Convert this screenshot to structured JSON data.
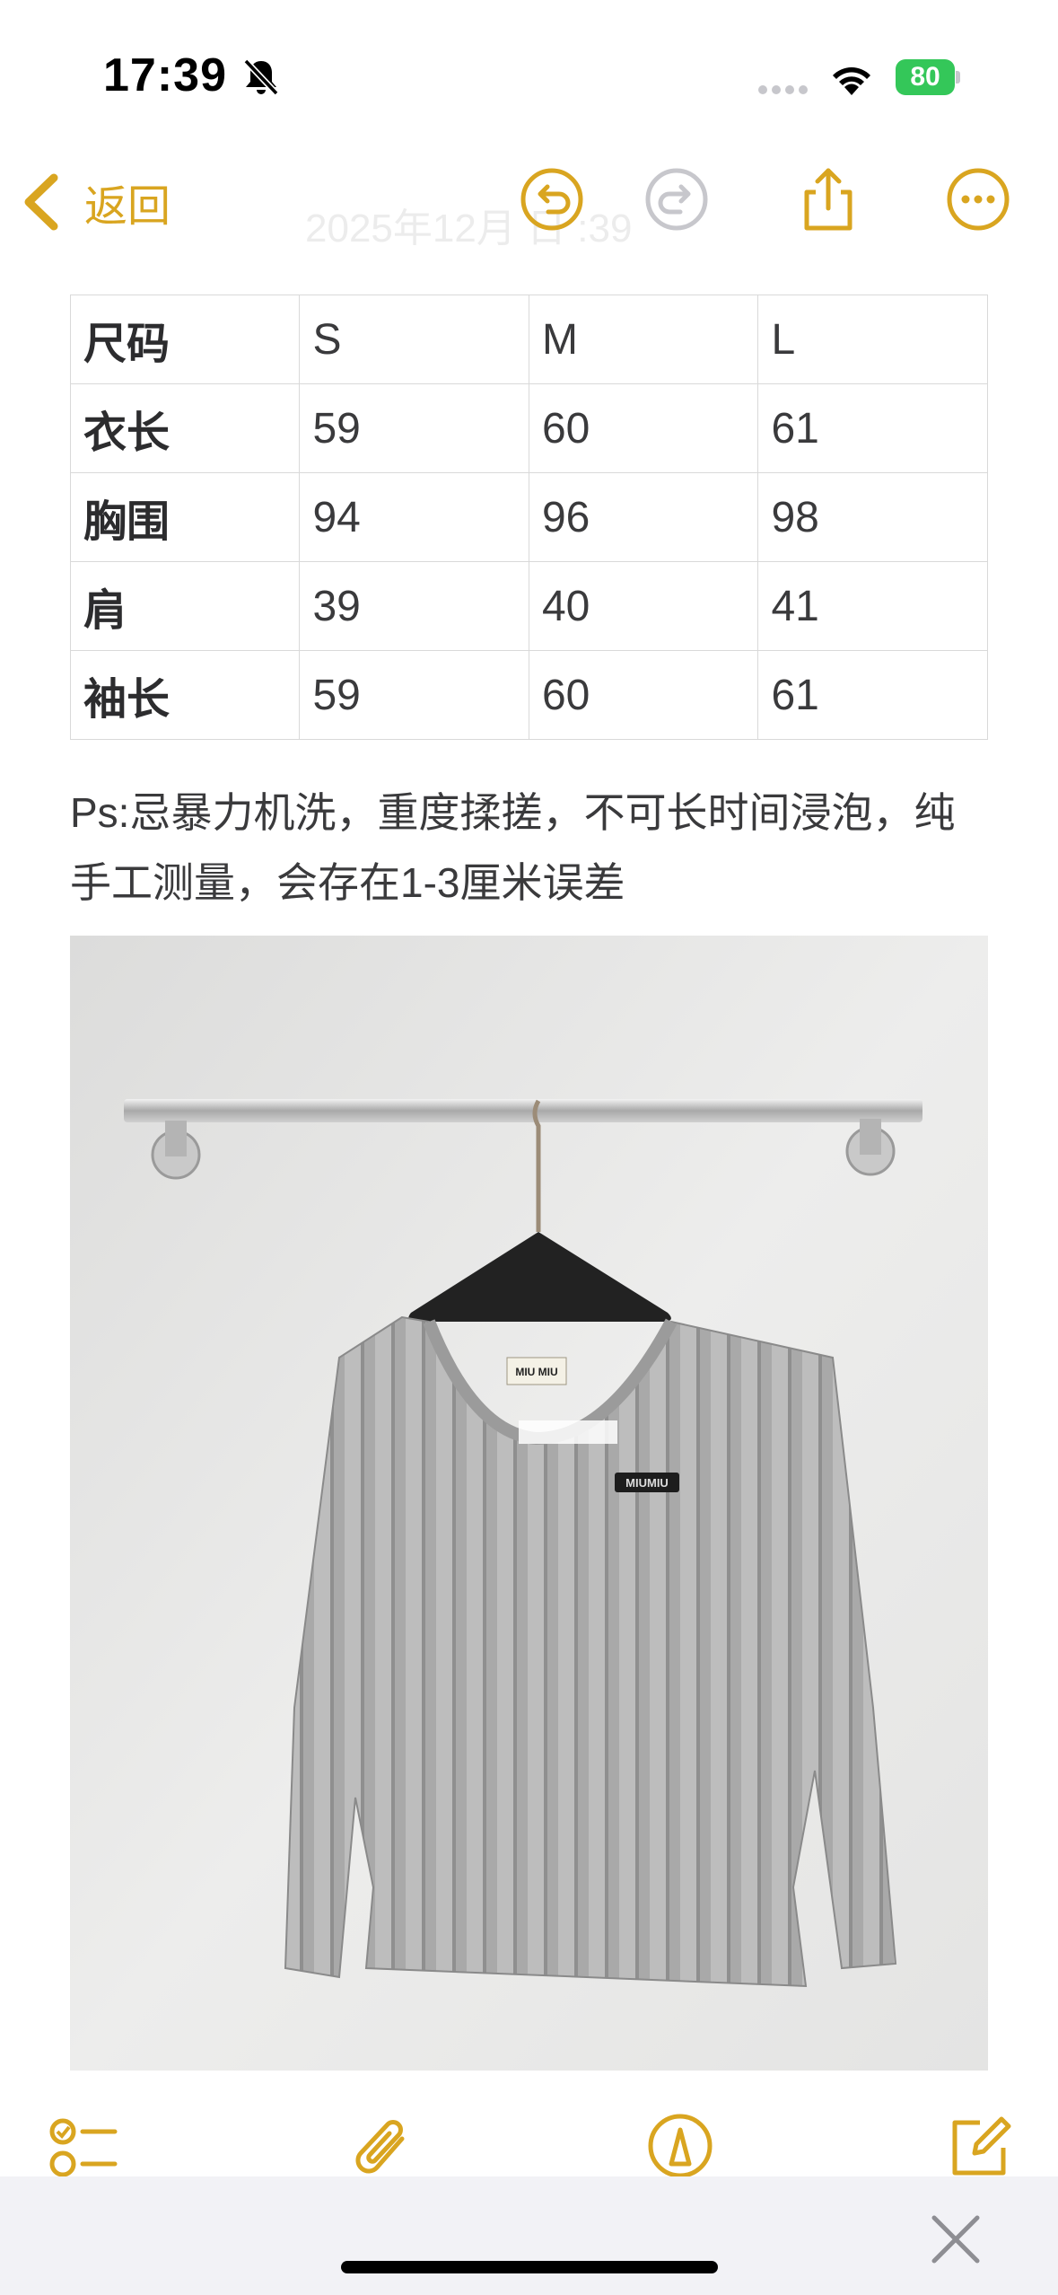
{
  "status_bar": {
    "time": "17:39",
    "battery_percent": "80",
    "silent_icon": "bell-slash-icon",
    "wifi_icon": "wifi-icon"
  },
  "nav": {
    "back_label": "返回",
    "faded_title": "2025年12月  日  :39",
    "icons": [
      "undo-icon",
      "redo-icon",
      "share-icon",
      "more-icon"
    ]
  },
  "size_table": {
    "rows": [
      [
        "尺码",
        "S",
        "M",
        "L"
      ],
      [
        "衣长",
        "59",
        "60",
        "61"
      ],
      [
        "胸围",
        "94",
        "96",
        "98"
      ],
      [
        "肩",
        "39",
        "40",
        "41"
      ],
      [
        "袖长",
        "59",
        "60",
        "61"
      ]
    ]
  },
  "note_text": "Ps:忌暴力机洗，重度揉搓，不可长时间浸泡，纯手工测量，会存在1-3厘米误差",
  "photo": {
    "label_text": "MIU MIU",
    "badge_text": "MIUMIU"
  },
  "toolbar": {
    "icons": [
      "checklist-icon",
      "attachment-icon",
      "markup-icon",
      "compose-icon"
    ]
  },
  "colors": {
    "accent": "#d9a520",
    "battery": "#34c759"
  }
}
